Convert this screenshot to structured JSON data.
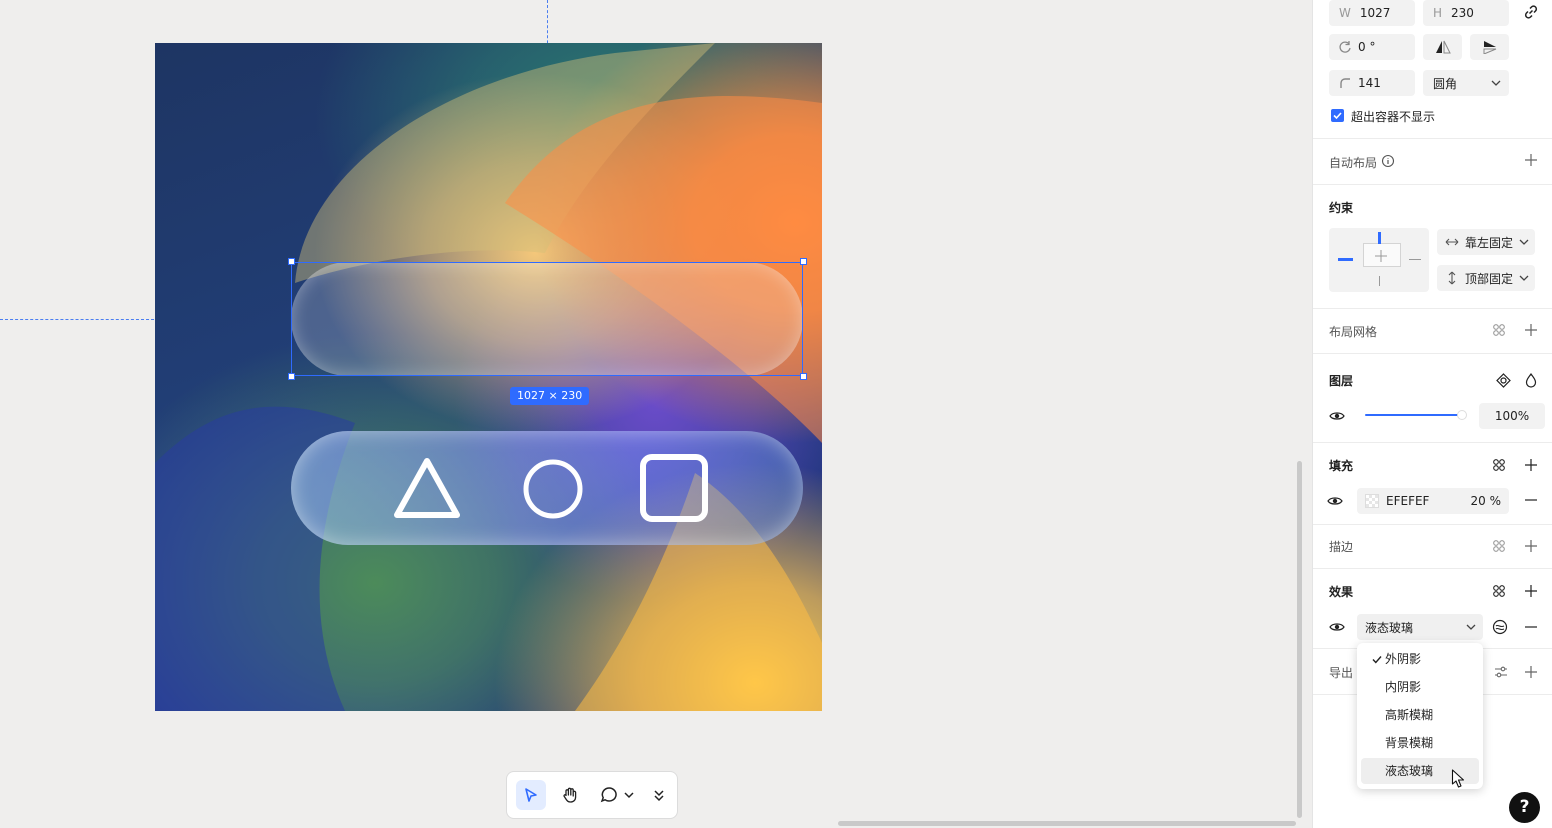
{
  "canvas": {
    "selection_size": "1027 × 230"
  },
  "toolbar": {
    "tools": [
      "move-tool",
      "hand-tool",
      "comment-tool",
      "more-tools"
    ]
  },
  "panel": {
    "size": {
      "w_label": "W",
      "w_value": "1027",
      "h_label": "H",
      "h_value": "230"
    },
    "rotation": {
      "value": "0 °"
    },
    "corner": {
      "radius": "141",
      "type": "圆角"
    },
    "clip_content": {
      "label": "超出容器不显示",
      "checked": true
    },
    "auto_layout": {
      "title": "自动布局"
    },
    "constraints": {
      "title": "约束",
      "horizontal": "靠左固定",
      "vertical": "顶部固定"
    },
    "layout_grid": {
      "title": "布局网格"
    },
    "layer": {
      "title": "图层",
      "opacity": "100",
      "opacity_unit": "%",
      "opacity_fraction": 1.0
    },
    "fill": {
      "title": "填充",
      "color": "EFEFEF",
      "opacity": "20",
      "opacity_unit": "%"
    },
    "stroke": {
      "title": "描边"
    },
    "effects": {
      "title": "效果",
      "selected": "液态玻璃"
    },
    "export": {
      "title": "导出"
    }
  },
  "effects_menu": {
    "items": [
      {
        "label": "外阴影",
        "checked": true
      },
      {
        "label": "内阴影",
        "checked": false
      },
      {
        "label": "高斯模糊",
        "checked": false
      },
      {
        "label": "背景模糊",
        "checked": false
      },
      {
        "label": "液态玻璃",
        "checked": false,
        "hovered": true
      }
    ]
  },
  "help": {
    "label": "?"
  },
  "colors": {
    "accent": "#2f6bff",
    "fill_swatch": "#EFEFEF"
  }
}
